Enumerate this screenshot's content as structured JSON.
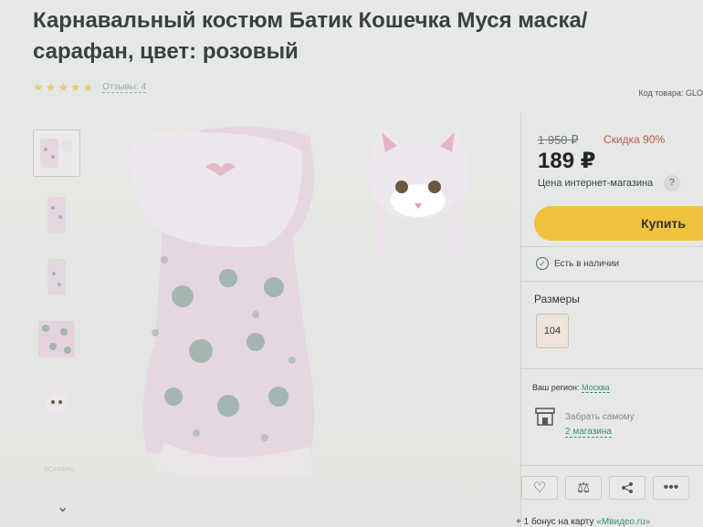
{
  "product": {
    "title": "Карнавальный костюм Батик Кошечка Муся маска/сарафан, цвет: розовый",
    "rating_stars": 5,
    "reviews_label": "Отзывы: 4",
    "sku_label": "Код товара: GLO"
  },
  "gallery": {
    "thumbs_count": 5,
    "bottom_label": "SCAREPC"
  },
  "buy_box": {
    "old_price": "1 950 ₽",
    "discount": "Скидка 90%",
    "price": "189 ₽",
    "price_note": "Цена интернет-магазина",
    "help": "?",
    "buy_label": "Купить",
    "stock": "Есть в наличии",
    "sizes_title": "Размеры",
    "size_option": "104",
    "region_label": "Ваш регион:",
    "region_value": "Москва",
    "pickup_label": "Забрать самому",
    "pickup_link": "2 магазина",
    "bonus_text": "+ 1 бонус на карту",
    "bonus_link": "«Мвидео.ru»"
  },
  "colors": {
    "accent_yellow": "#efc33c",
    "discount_red": "#c2544d",
    "link_teal": "#3f8a80",
    "dress_pink": "#e6d6e2",
    "cat_grey": "#a3b6b2"
  }
}
